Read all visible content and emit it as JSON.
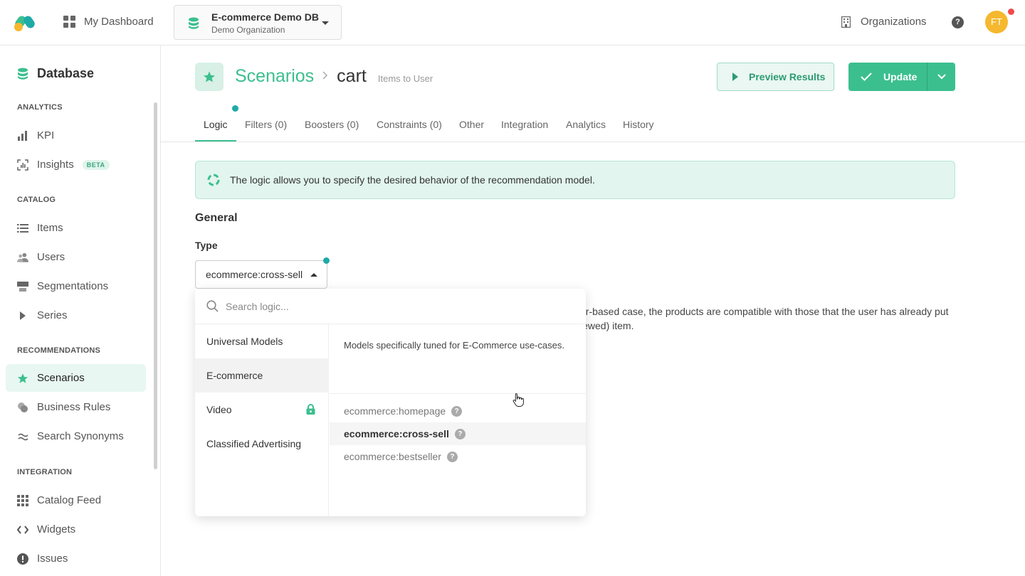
{
  "topbar": {
    "dashboard_label": "My Dashboard",
    "database_name": "E-commerce Demo DB",
    "organization_name": "Demo Organization",
    "organizations_label": "Organizations",
    "help_glyph": "?",
    "avatar_initials": "FT"
  },
  "sidebar": {
    "title": "Database",
    "sections": {
      "analytics": "ANALYTICS",
      "catalog": "CATALOG",
      "recommendations": "RECOMMENDATIONS",
      "integration": "INTEGRATION"
    },
    "items": {
      "kpi": "KPI",
      "insights": "Insights",
      "insights_badge": "BETA",
      "items": "Items",
      "users": "Users",
      "segmentations": "Segmentations",
      "series": "Series",
      "scenarios": "Scenarios",
      "business_rules": "Business Rules",
      "search_synonyms": "Search Synonyms",
      "catalog_feed": "Catalog Feed",
      "widgets": "Widgets",
      "issues": "Issues"
    }
  },
  "header": {
    "breadcrumb_root": "Scenarios",
    "breadcrumb_current": "cart",
    "subtitle": "Items to User",
    "preview_label": "Preview Results",
    "update_label": "Update"
  },
  "tabs": {
    "logic": "Logic",
    "filters": "Filters (0)",
    "boosters": "Boosters (0)",
    "constraints": "Constraints (0)",
    "other": "Other",
    "integration": "Integration",
    "analytics": "Analytics",
    "history": "History"
  },
  "info_text": "The logic allows you to specify the desired behavior of the recommendation model.",
  "general": {
    "heading": "General",
    "type_label": "Type",
    "type_value": "ecommerce:cross-sell",
    "description_line1": "er-based case, the products are compatible with those that the user has already put",
    "description_line2": "iewed) item."
  },
  "dropdown": {
    "search_placeholder": "Search logic...",
    "categories": {
      "universal": "Universal Models",
      "ecommerce": "E-commerce",
      "video": "Video",
      "classified": "Classified Advertising"
    },
    "category_description": "Models specifically tuned for E-Commerce use-cases.",
    "options": {
      "homepage": "ecommerce:homepage",
      "cross_sell": "ecommerce:cross-sell",
      "bestseller": "ecommerce:bestseller"
    }
  },
  "colors": {
    "accent": "#3cbf8f",
    "accent_light": "#e2f5ee",
    "notification": "#f04a4a",
    "avatar": "#f5b82e",
    "dot": "#1eaaa6"
  },
  "icons": [
    "logo-icon",
    "grid-icon",
    "database-icon",
    "building-icon",
    "help-icon",
    "bar-chart-icon",
    "insights-icon",
    "list-icon",
    "users-icon",
    "segmentation-icon",
    "play-icon",
    "star-icon",
    "business-rules-icon",
    "approx-icon",
    "catalog-feed-icon",
    "code-icon",
    "alert-icon",
    "check-icon",
    "chevron-down-icon",
    "chevron-right-icon",
    "lifebuoy-icon",
    "search-icon",
    "lock-icon",
    "pointer-cursor-icon"
  ]
}
